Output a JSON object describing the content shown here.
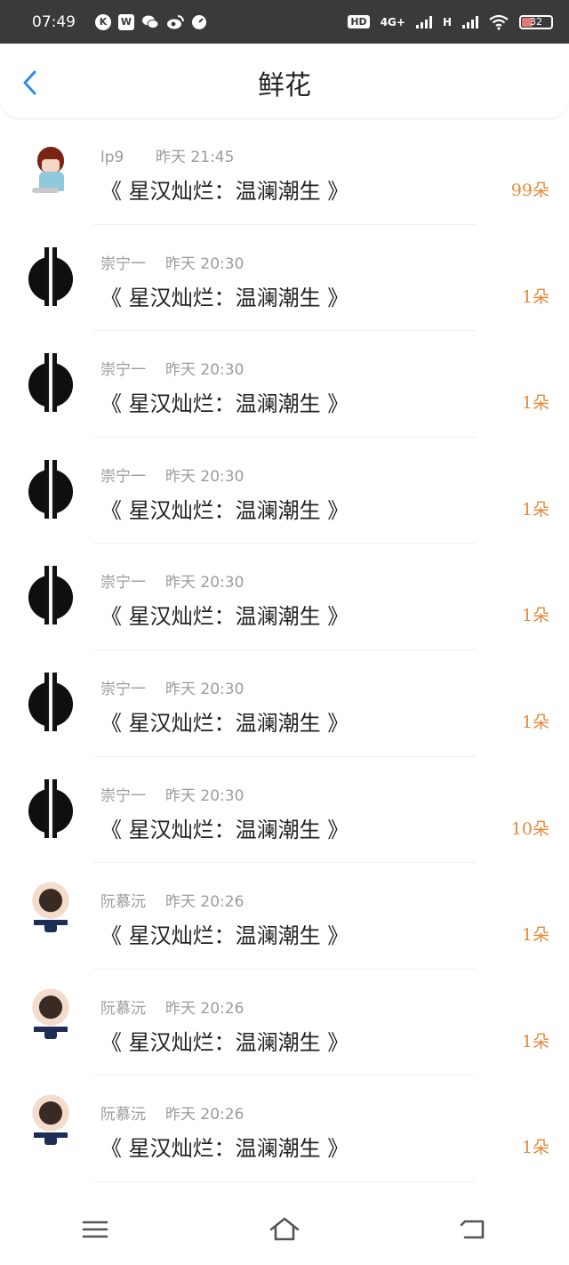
{
  "status_bar": {
    "time": "07:49",
    "left_icons": [
      "K",
      "W",
      "wechat",
      "weibo",
      "gauge"
    ],
    "hd_label": "HD",
    "network_4g": "4G+",
    "network_h": "H",
    "battery": "32"
  },
  "header": {
    "title": "鲜花"
  },
  "gifts": [
    {
      "sender": "lp9",
      "time": "昨天 21:45",
      "book": "《 星汉灿烂：温澜潮生 》",
      "count": "99朵",
      "avatar": "chibi"
    },
    {
      "sender": "崇宁一",
      "time": "昨天 20:30",
      "book": "《 星汉灿烂：温澜潮生 》",
      "count": "1朵",
      "avatar": "dark"
    },
    {
      "sender": "崇宁一",
      "time": "昨天 20:30",
      "book": "《 星汉灿烂：温澜潮生 》",
      "count": "1朵",
      "avatar": "dark"
    },
    {
      "sender": "崇宁一",
      "time": "昨天 20:30",
      "book": "《 星汉灿烂：温澜潮生 》",
      "count": "1朵",
      "avatar": "dark"
    },
    {
      "sender": "崇宁一",
      "time": "昨天 20:30",
      "book": "《 星汉灿烂：温澜潮生 》",
      "count": "1朵",
      "avatar": "dark"
    },
    {
      "sender": "崇宁一",
      "time": "昨天 20:30",
      "book": "《 星汉灿烂：温澜潮生 》",
      "count": "1朵",
      "avatar": "dark"
    },
    {
      "sender": "崇宁一",
      "time": "昨天 20:30",
      "book": "《 星汉灿烂：温澜潮生 》",
      "count": "10朵",
      "avatar": "dark"
    },
    {
      "sender": "阮慕沅",
      "time": "昨天 20:26",
      "book": "《 星汉灿烂：温澜潮生 》",
      "count": "1朵",
      "avatar": "girl"
    },
    {
      "sender": "阮慕沅",
      "time": "昨天 20:26",
      "book": "《 星汉灿烂：温澜潮生 》",
      "count": "1朵",
      "avatar": "girl"
    },
    {
      "sender": "阮慕沅",
      "time": "昨天 20:26",
      "book": "《 星汉灿烂：温澜潮生 》",
      "count": "1朵",
      "avatar": "girl"
    }
  ],
  "colors": {
    "accent_blue": "#2a8ee8",
    "count_orange": "#e5893a",
    "status_bar_bg": "#3a3a3a"
  },
  "nav_icons": [
    "menu-icon",
    "home-icon",
    "back-return-icon"
  ]
}
